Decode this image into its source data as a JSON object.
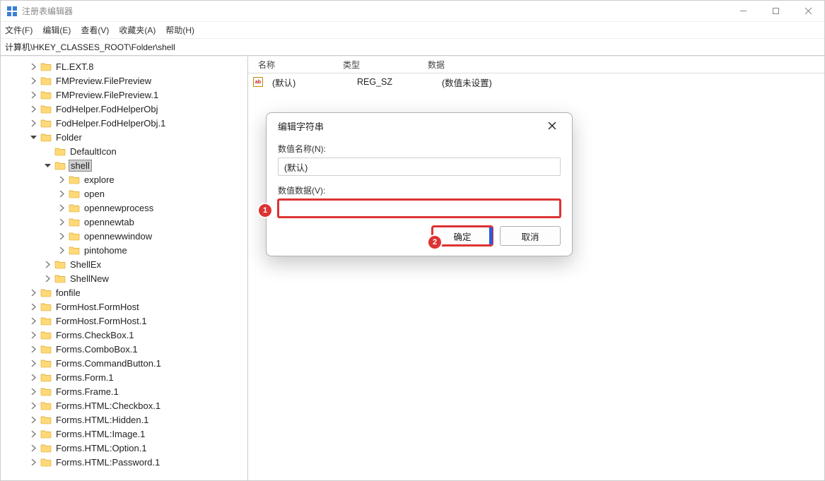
{
  "window": {
    "title": "注册表编辑器"
  },
  "menubar": {
    "file": "文件(F)",
    "edit": "编辑(E)",
    "view": "查看(V)",
    "fav": "收藏夹(A)",
    "help": "帮助(H)"
  },
  "address": "计算机\\HKEY_CLASSES_ROOT\\Folder\\shell",
  "tree": [
    {
      "depth": 0,
      "exp": "c",
      "label": "FL.EXT.8"
    },
    {
      "depth": 0,
      "exp": "c",
      "label": "FMPreview.FilePreview"
    },
    {
      "depth": 0,
      "exp": "c",
      "label": "FMPreview.FilePreview.1"
    },
    {
      "depth": 0,
      "exp": "c",
      "label": "FodHelper.FodHelperObj"
    },
    {
      "depth": 0,
      "exp": "c",
      "label": "FodHelper.FodHelperObj.1"
    },
    {
      "depth": 0,
      "exp": "o",
      "label": "Folder"
    },
    {
      "depth": 1,
      "exp": "n",
      "label": "DefaultIcon"
    },
    {
      "depth": 1,
      "exp": "o",
      "label": "shell",
      "selected": true
    },
    {
      "depth": 2,
      "exp": "c",
      "label": "explore"
    },
    {
      "depth": 2,
      "exp": "c",
      "label": "open"
    },
    {
      "depth": 2,
      "exp": "c",
      "label": "opennewprocess"
    },
    {
      "depth": 2,
      "exp": "c",
      "label": "opennewtab"
    },
    {
      "depth": 2,
      "exp": "c",
      "label": "opennewwindow"
    },
    {
      "depth": 2,
      "exp": "c",
      "label": "pintohome"
    },
    {
      "depth": 1,
      "exp": "c",
      "label": "ShellEx"
    },
    {
      "depth": 1,
      "exp": "c",
      "label": "ShellNew"
    },
    {
      "depth": 0,
      "exp": "c",
      "label": "fonfile"
    },
    {
      "depth": 0,
      "exp": "c",
      "label": "FormHost.FormHost"
    },
    {
      "depth": 0,
      "exp": "c",
      "label": "FormHost.FormHost.1"
    },
    {
      "depth": 0,
      "exp": "c",
      "label": "Forms.CheckBox.1"
    },
    {
      "depth": 0,
      "exp": "c",
      "label": "Forms.ComboBox.1"
    },
    {
      "depth": 0,
      "exp": "c",
      "label": "Forms.CommandButton.1"
    },
    {
      "depth": 0,
      "exp": "c",
      "label": "Forms.Form.1"
    },
    {
      "depth": 0,
      "exp": "c",
      "label": "Forms.Frame.1"
    },
    {
      "depth": 0,
      "exp": "c",
      "label": "Forms.HTML:Checkbox.1"
    },
    {
      "depth": 0,
      "exp": "c",
      "label": "Forms.HTML:Hidden.1"
    },
    {
      "depth": 0,
      "exp": "c",
      "label": "Forms.HTML:Image.1"
    },
    {
      "depth": 0,
      "exp": "c",
      "label": "Forms.HTML:Option.1"
    },
    {
      "depth": 0,
      "exp": "c",
      "label": "Forms.HTML:Password.1"
    }
  ],
  "list": {
    "headers": {
      "name": "名称",
      "type": "类型",
      "data": "数据"
    },
    "rows": [
      {
        "icon": "ab",
        "name": "(默认)",
        "type": "REG_SZ",
        "data": "(数值未设置)"
      }
    ]
  },
  "dialog": {
    "title": "编辑字符串",
    "name_label": "数值名称(N):",
    "name_value": "(默认)",
    "data_label": "数值数据(V):",
    "data_value": "",
    "ok": "确定",
    "cancel": "取消"
  },
  "markers": {
    "m1": "1",
    "m2": "2"
  }
}
